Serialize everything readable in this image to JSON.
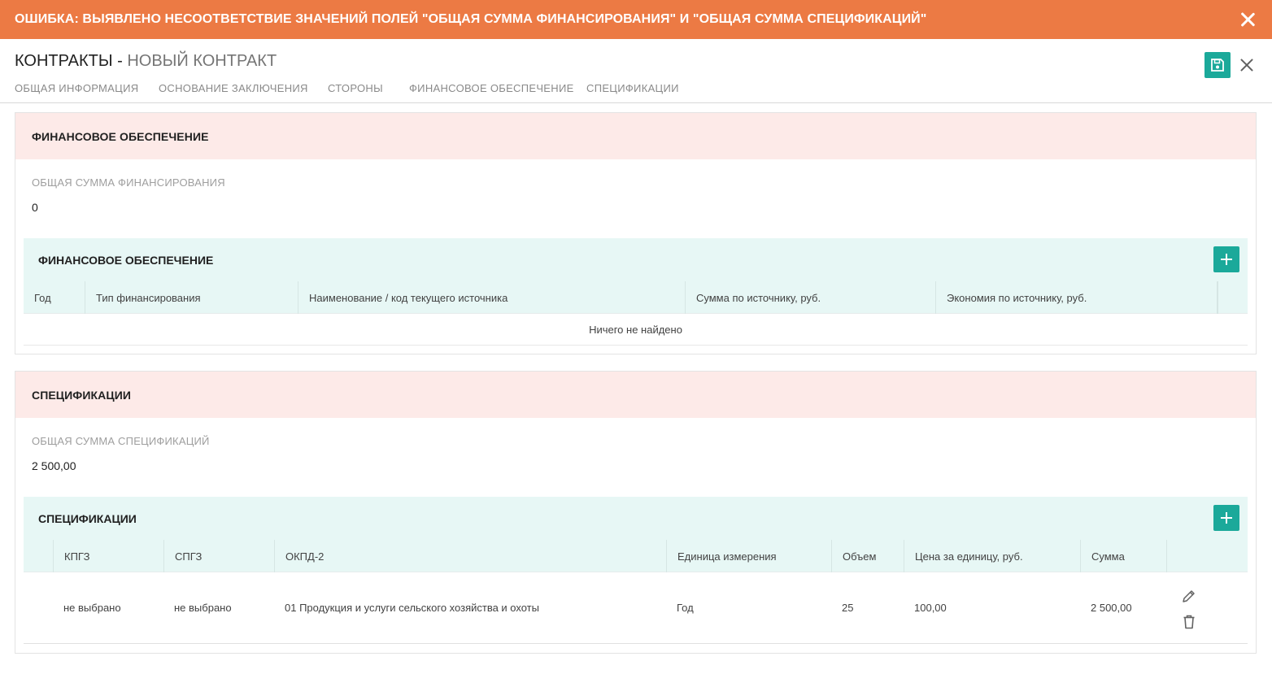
{
  "error": {
    "message": "ОШИБКА: ВЫЯВЛЕНО НЕСООТВЕТСТВИЕ ЗНАЧЕНИЙ ПОЛЕЙ \"ОБЩАЯ СУММА ФИНАНСИРОВАНИЯ\" И \"ОБЩАЯ СУММА СПЕЦИФИКАЦИЙ\"",
    "close_icon": "close-icon",
    "bg_color": "#ec7a44"
  },
  "header": {
    "title_main": "КОНТРАКТЫ",
    "title_separator": " - ",
    "title_sub": "НОВЫЙ КОНТРАКТ",
    "save_icon": "save-icon",
    "close_icon": "close-icon"
  },
  "tabs": [
    {
      "label": "ОБЩАЯ ИНФОРМАЦИЯ"
    },
    {
      "label": "ОСНОВАНИЕ ЗАКЛЮЧЕНИЯ"
    },
    {
      "label": "СТОРОНЫ"
    },
    {
      "label": "ФИНАНСОВОЕ ОБЕСПЕЧЕНИЕ"
    },
    {
      "label": "СПЕЦИФИКАЦИИ"
    }
  ],
  "financing": {
    "section_title": "ФИНАНСОВОЕ ОБЕСПЕЧЕНИЕ",
    "total_label": "ОБЩАЯ СУММА ФИНАНСИРОВАНИЯ",
    "total_value": "0",
    "table": {
      "title": "ФИНАНСОВОЕ ОБЕСПЕЧЕНИЕ",
      "columns": [
        "Год",
        "Тип финансирования",
        "Наименование / код текущего источника",
        "Сумма по источнику, руб.",
        "Экономия по источнику, руб."
      ],
      "empty_text": "Ничего не найдено"
    }
  },
  "specs": {
    "section_title": "СПЕЦИФИКАЦИИ",
    "total_label": "ОБЩАЯ СУММА СПЕЦИФИКАЦИЙ",
    "total_value": "2 500,00",
    "table": {
      "title": "СПЕЦИФИКАЦИИ",
      "columns": [
        "КПГЗ",
        "СПГЗ",
        "ОКПД-2",
        "Единица измерения",
        "Объем",
        "Цена за единицу, руб.",
        "Сумма"
      ],
      "rows": [
        [
          "не выбрано",
          "не выбрано",
          "01 Продукция и услуги сельского хозяйства и охоты",
          "Год",
          "25",
          "100,00",
          "2 500,00"
        ]
      ],
      "row_action_icons": [
        "pencil-icon",
        "trash-icon"
      ]
    }
  },
  "colors": {
    "accent": "#1ba99a",
    "section_header_bg": "#fdeae8",
    "table_header_bg": "#e7f7f5"
  }
}
